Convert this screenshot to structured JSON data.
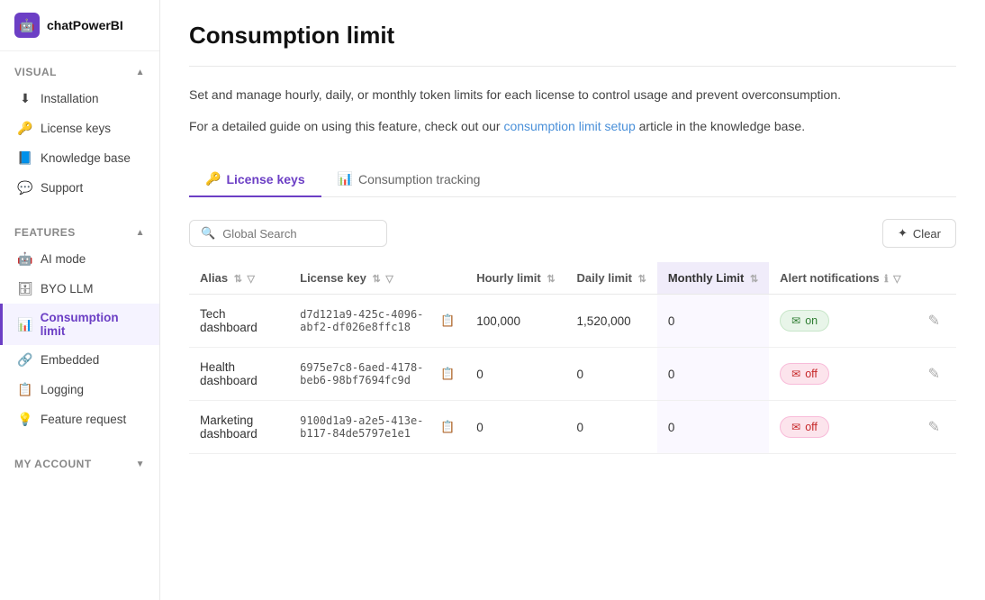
{
  "app": {
    "name": "chatPowerBI",
    "logo_char": "🤖"
  },
  "sidebar": {
    "visual_section": "Visual",
    "features_section": "Features",
    "my_account_section": "My account",
    "items_visual": [
      {
        "id": "installation",
        "label": "Installation",
        "icon": "⬇"
      },
      {
        "id": "license-keys",
        "label": "License keys",
        "icon": "🔑"
      },
      {
        "id": "knowledge-base",
        "label": "Knowledge base",
        "icon": "📘"
      },
      {
        "id": "support",
        "label": "Support",
        "icon": "💬"
      }
    ],
    "items_features": [
      {
        "id": "ai-mode",
        "label": "AI mode",
        "icon": "🤖"
      },
      {
        "id": "byo-llm",
        "label": "BYO LLM",
        "icon": "🗄"
      },
      {
        "id": "consumption-limit",
        "label": "Consumption limit",
        "icon": "📊",
        "active": true
      },
      {
        "id": "embedded",
        "label": "Embedded",
        "icon": "🔗"
      },
      {
        "id": "logging",
        "label": "Logging",
        "icon": "📋"
      },
      {
        "id": "feature-request",
        "label": "Feature request",
        "icon": "💡"
      }
    ]
  },
  "page": {
    "title": "Consumption limit",
    "description1": "Set and manage hourly, daily, or monthly token limits for each license to control usage and prevent overconsumption.",
    "description2_prefix": "For a detailed guide on using this feature, check out our ",
    "description2_link": "consumption limit setup",
    "description2_suffix": " article in the knowledge base.",
    "tabs": [
      {
        "id": "license-keys",
        "label": "License keys",
        "icon": "🔑",
        "active": true
      },
      {
        "id": "consumption-tracking",
        "label": "Consumption tracking",
        "icon": "📊",
        "active": false
      }
    ]
  },
  "toolbar": {
    "search_placeholder": "Global Search",
    "clear_label": "Clear"
  },
  "table": {
    "columns": [
      {
        "id": "alias",
        "label": "Alias",
        "sortable": true,
        "filterable": true
      },
      {
        "id": "license-key",
        "label": "License key",
        "sortable": true,
        "filterable": true
      },
      {
        "id": "hourly-limit",
        "label": "Hourly limit",
        "sortable": true
      },
      {
        "id": "daily-limit",
        "label": "Daily limit",
        "sortable": true
      },
      {
        "id": "monthly-limit",
        "label": "Monthly Limit",
        "sortable": true,
        "highlight": true
      },
      {
        "id": "alert-notifications",
        "label": "Alert notifications",
        "info": true,
        "filterable": true
      }
    ],
    "rows": [
      {
        "alias": "Tech dashboard",
        "license_key": "d7d121a9-425c-4096-abf2-df026e8ffc18",
        "hourly_limit": "100,000",
        "daily_limit": "1,520,000",
        "monthly_limit": "0",
        "alert_status": "on",
        "alert_status_label": "on"
      },
      {
        "alias": "Health dashboard",
        "license_key": "6975e7c8-6aed-4178-beb6-98bf7694fc9d",
        "hourly_limit": "0",
        "daily_limit": "0",
        "monthly_limit": "0",
        "alert_status": "off",
        "alert_status_label": "off"
      },
      {
        "alias": "Marketing dashboard",
        "license_key": "9100d1a9-a2e5-413e-b117-84de5797e1e1",
        "hourly_limit": "0",
        "daily_limit": "0",
        "monthly_limit": "0",
        "alert_status": "off",
        "alert_status_label": "off"
      }
    ]
  }
}
